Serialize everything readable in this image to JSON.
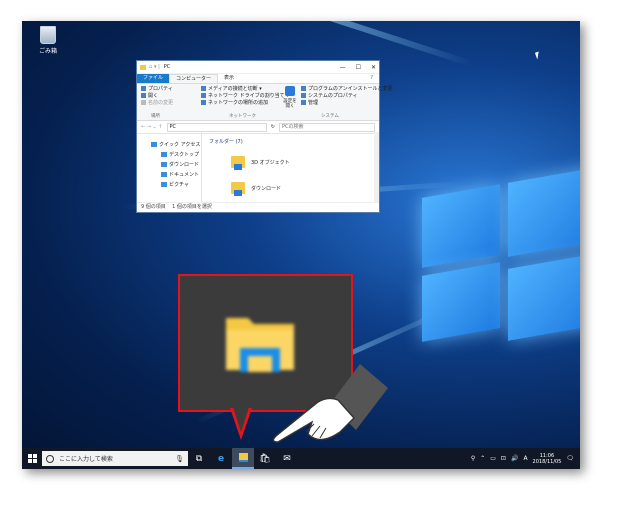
{
  "desktop": {
    "recycle_bin_label": "ごみ箱"
  },
  "explorer": {
    "title": "PC",
    "window_controls": [
      "—",
      "☐",
      "✕"
    ],
    "ribbon_tabs": [
      "ファイル",
      "コンピューター",
      "表示"
    ],
    "location_group": {
      "items": [
        "プロパティ",
        "開く",
        "名前の変更"
      ],
      "caption": "場所"
    },
    "network_group": {
      "items": [
        "メディアの接続と切断 ▾",
        "ネットワーク ドライブの割り当て ▾",
        "ネットワークの場所の追加"
      ],
      "caption": "ネットワーク"
    },
    "settings_label": "設定を開く",
    "system_group": {
      "items": [
        "プログラムのアンインストールと変更",
        "システムのプロパティ",
        "管理"
      ],
      "caption": "システム"
    },
    "address_path": "PC",
    "search_placeholder": "PCの検索",
    "nav": {
      "quick_access": "クイック アクセス",
      "items": [
        "デスクトップ",
        "ダウンロード",
        "ドキュメント",
        "ピクチャ"
      ]
    },
    "folders_header": "フォルダー (7)",
    "folders": [
      "3D オブジェクト",
      "ダウンロード"
    ],
    "status_items": "9 個の項目",
    "status_selected": "1 個の項目を選択"
  },
  "taskbar": {
    "search_placeholder": "ここに入力して検索",
    "ime_label": "A",
    "time": "11:06",
    "date": "2018/11/05"
  }
}
